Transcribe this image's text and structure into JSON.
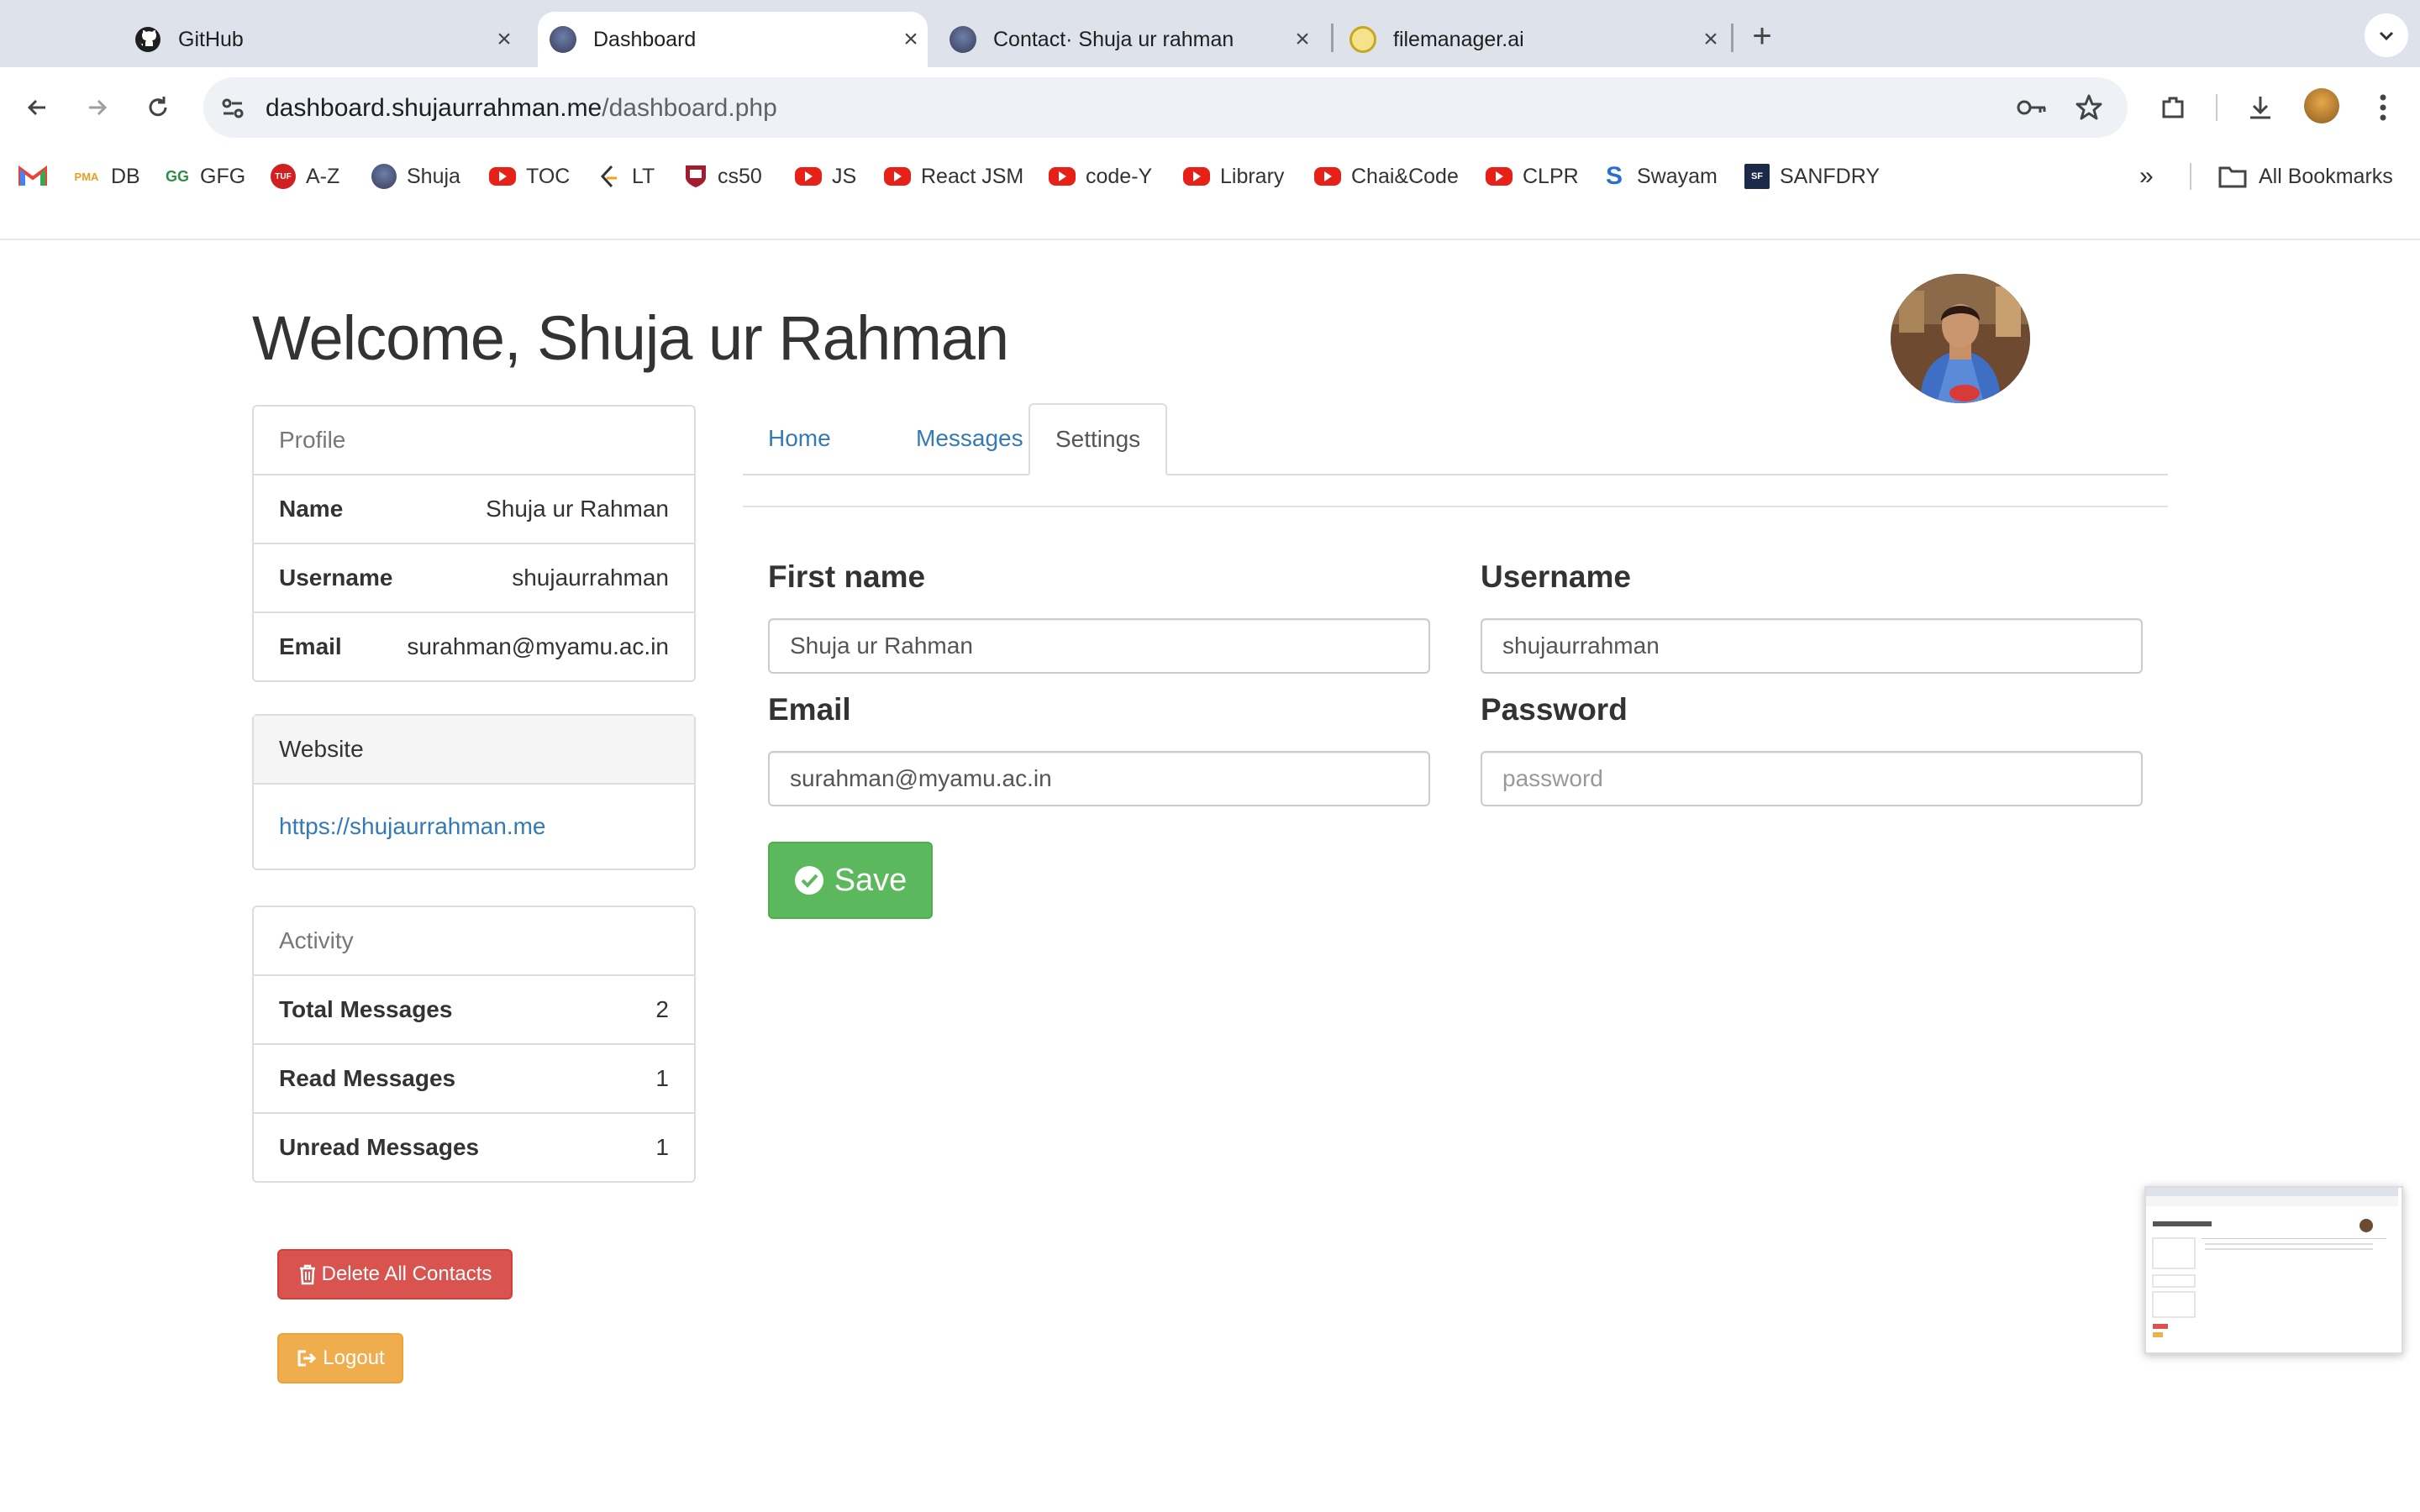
{
  "browser": {
    "tabs": [
      {
        "title": "GitHub",
        "icon": "github-icon"
      },
      {
        "title": "Dashboard",
        "icon": "avatar-favicon",
        "active": true
      },
      {
        "title": "Contact· Shuja ur rahman",
        "icon": "avatar-favicon"
      },
      {
        "title": "filemanager.ai",
        "icon": "filemanager-icon"
      }
    ],
    "url_host": "dashboard.shujaurrahman.me",
    "url_path": "/dashboard.php",
    "bookmarks": [
      {
        "label": "",
        "icon": "gmail-icon"
      },
      {
        "label": "DB",
        "icon": "pma-icon"
      },
      {
        "label": "GFG",
        "icon": "gfg-icon"
      },
      {
        "label": "A-Z",
        "icon": "tuf-icon"
      },
      {
        "label": "Shuja",
        "icon": "avatar-favicon"
      },
      {
        "label": "TOC",
        "icon": "youtube-icon"
      },
      {
        "label": "LT",
        "icon": "leetcode-icon"
      },
      {
        "label": "cs50",
        "icon": "harvard-icon"
      },
      {
        "label": "JS",
        "icon": "youtube-icon"
      },
      {
        "label": "React JSM",
        "icon": "youtube-icon"
      },
      {
        "label": "code-Y",
        "icon": "youtube-icon"
      },
      {
        "label": "Library",
        "icon": "youtube-icon"
      },
      {
        "label": "Chai&Code",
        "icon": "youtube-icon"
      },
      {
        "label": "CLPR",
        "icon": "youtube-icon"
      },
      {
        "label": "Swayam",
        "icon": "swayam-icon"
      },
      {
        "label": "SANFDRY",
        "icon": "sanfdry-icon"
      }
    ],
    "all_bookmarks": "All Bookmarks",
    "gfg_badge": "GG",
    "tuf_badge": "TUF",
    "pma_badge": "PMA",
    "swayam_badge": "S",
    "sanfdry_badge": "SF"
  },
  "page": {
    "welcome": "Welcome, Shuja ur Rahman",
    "profile": {
      "heading": "Profile",
      "rows": [
        {
          "label": "Name",
          "value": "Shuja ur Rahman"
        },
        {
          "label": "Username",
          "value": "shujaurrahman"
        },
        {
          "label": "Email",
          "value": "surahman@myamu.ac.in"
        }
      ]
    },
    "website": {
      "heading": "Website",
      "link": "https://shujaurrahman.me"
    },
    "activity": {
      "heading": "Activity",
      "rows": [
        {
          "label": "Total Messages",
          "value": "2"
        },
        {
          "label": "Read Messages",
          "value": "1"
        },
        {
          "label": "Unread Messages",
          "value": "1"
        }
      ]
    },
    "nav_tabs": [
      "Home",
      "Messages",
      "Settings"
    ],
    "active_tab": "Settings",
    "form": {
      "first_name_label": "First name",
      "first_name_value": "Shuja ur Rahman",
      "username_label": "Username",
      "username_value": "shujaurrahman",
      "email_label": "Email",
      "email_value": "surahman@myamu.ac.in",
      "password_label": "Password",
      "password_placeholder": "password",
      "save_label": "Save"
    },
    "delete_label": "Delete All Contacts",
    "logout_label": "Logout"
  },
  "colors": {
    "primary_link": "#337ab7",
    "success": "#5cb85c",
    "danger": "#d9534f",
    "warning": "#f0ad4e"
  }
}
